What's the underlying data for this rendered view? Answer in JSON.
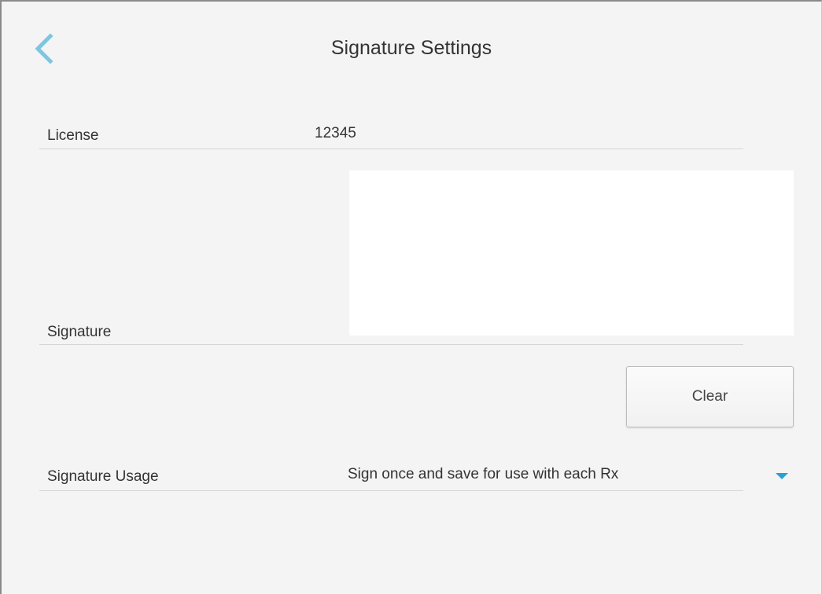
{
  "header": {
    "title": "Signature Settings",
    "back_icon": "chevron-left-icon",
    "accent_color": "#7cc6e2"
  },
  "license": {
    "label": "License",
    "value": "12345"
  },
  "signature": {
    "label": "Signature",
    "clear_label": "Clear"
  },
  "usage": {
    "label": "Signature Usage",
    "selected": "Sign once and save for use with each Rx",
    "arrow_icon": "caret-down-icon",
    "arrow_color": "#2a9fd8"
  }
}
